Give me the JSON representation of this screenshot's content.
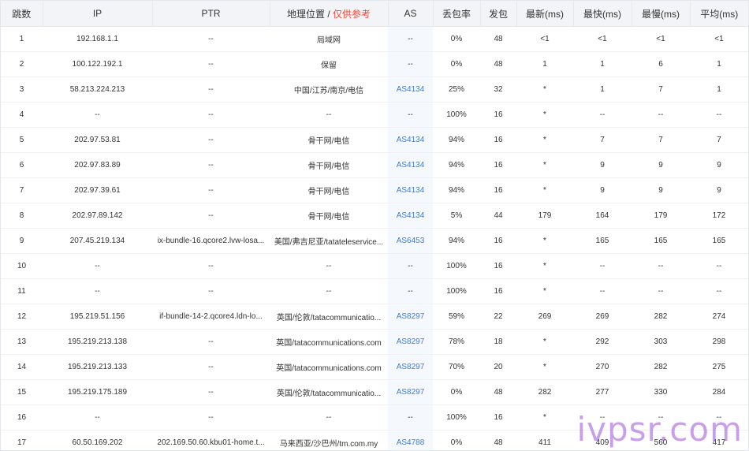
{
  "headers": {
    "hop": "跳数",
    "ip": "IP",
    "ptr": "PTR",
    "geo": "地理位置 / ",
    "geo_ref": "仅供参考",
    "as": "AS",
    "loss": "丢包率",
    "sent": "发包",
    "last": "最新(ms)",
    "best": "最快(ms)",
    "worst": "最慢(ms)",
    "avg": "平均(ms)"
  },
  "rows": [
    {
      "hop": "1",
      "ip": "192.168.1.1",
      "ptr": "--",
      "geo": "局域网",
      "as": "--",
      "loss": "0%",
      "sent": "48",
      "last": "<1",
      "best": "<1",
      "worst": "<1",
      "avg": "<1"
    },
    {
      "hop": "2",
      "ip": "100.122.192.1",
      "ptr": "--",
      "geo": "保留",
      "as": "--",
      "loss": "0%",
      "sent": "48",
      "last": "1",
      "best": "1",
      "worst": "6",
      "avg": "1"
    },
    {
      "hop": "3",
      "ip": "58.213.224.213",
      "ptr": "--",
      "geo": "中国/江苏/南京/电信",
      "as": "AS4134",
      "loss": "25%",
      "sent": "32",
      "last": "*",
      "best": "1",
      "worst": "7",
      "avg": "1"
    },
    {
      "hop": "4",
      "ip": "--",
      "ptr": "--",
      "geo": "--",
      "as": "--",
      "loss": "100%",
      "sent": "16",
      "last": "*",
      "best": "--",
      "worst": "--",
      "avg": "--"
    },
    {
      "hop": "5",
      "ip": "202.97.53.81",
      "ptr": "--",
      "geo": "骨干网/电信",
      "as": "AS4134",
      "loss": "94%",
      "sent": "16",
      "last": "*",
      "best": "7",
      "worst": "7",
      "avg": "7"
    },
    {
      "hop": "6",
      "ip": "202.97.83.89",
      "ptr": "--",
      "geo": "骨干网/电信",
      "as": "AS4134",
      "loss": "94%",
      "sent": "16",
      "last": "*",
      "best": "9",
      "worst": "9",
      "avg": "9"
    },
    {
      "hop": "7",
      "ip": "202.97.39.61",
      "ptr": "--",
      "geo": "骨干网/电信",
      "as": "AS4134",
      "loss": "94%",
      "sent": "16",
      "last": "*",
      "best": "9",
      "worst": "9",
      "avg": "9"
    },
    {
      "hop": "8",
      "ip": "202.97.89.142",
      "ptr": "--",
      "geo": "骨干网/电信",
      "as": "AS4134",
      "loss": "5%",
      "sent": "44",
      "last": "179",
      "best": "164",
      "worst": "179",
      "avg": "172"
    },
    {
      "hop": "9",
      "ip": "207.45.219.134",
      "ptr": "ix-bundle-16.qcore2.lvw-losa...",
      "geo": "美国/弗吉尼亚/tatateleservice...",
      "as": "AS6453",
      "loss": "94%",
      "sent": "16",
      "last": "*",
      "best": "165",
      "worst": "165",
      "avg": "165"
    },
    {
      "hop": "10",
      "ip": "--",
      "ptr": "--",
      "geo": "--",
      "as": "--",
      "loss": "100%",
      "sent": "16",
      "last": "*",
      "best": "--",
      "worst": "--",
      "avg": "--"
    },
    {
      "hop": "11",
      "ip": "--",
      "ptr": "--",
      "geo": "--",
      "as": "--",
      "loss": "100%",
      "sent": "16",
      "last": "*",
      "best": "--",
      "worst": "--",
      "avg": "--"
    },
    {
      "hop": "12",
      "ip": "195.219.51.156",
      "ptr": "if-bundle-14-2.qcore4.ldn-lo...",
      "geo": "英国/伦敦/tatacommunicatio...",
      "as": "AS8297",
      "loss": "59%",
      "sent": "22",
      "last": "269",
      "best": "269",
      "worst": "282",
      "avg": "274"
    },
    {
      "hop": "13",
      "ip": "195.219.213.138",
      "ptr": "--",
      "geo": "英国/tatacommunications.com",
      "as": "AS8297",
      "loss": "78%",
      "sent": "18",
      "last": "*",
      "best": "292",
      "worst": "303",
      "avg": "298"
    },
    {
      "hop": "14",
      "ip": "195.219.213.133",
      "ptr": "--",
      "geo": "英国/tatacommunications.com",
      "as": "AS8297",
      "loss": "70%",
      "sent": "20",
      "last": "*",
      "best": "270",
      "worst": "282",
      "avg": "275"
    },
    {
      "hop": "15",
      "ip": "195.219.175.189",
      "ptr": "--",
      "geo": "英国/伦敦/tatacommunicatio...",
      "as": "AS8297",
      "loss": "0%",
      "sent": "48",
      "last": "282",
      "best": "277",
      "worst": "330",
      "avg": "284"
    },
    {
      "hop": "16",
      "ip": "--",
      "ptr": "--",
      "geo": "--",
      "as": "--",
      "loss": "100%",
      "sent": "16",
      "last": "*",
      "best": "--",
      "worst": "--",
      "avg": "--"
    },
    {
      "hop": "17",
      "ip": "60.50.169.202",
      "ptr": "202.169.50.60.kbu01-home.t...",
      "geo": "马来西亚/沙巴州/tm.com.my",
      "as": "AS4788",
      "loss": "0%",
      "sent": "48",
      "last": "411",
      "best": "409",
      "worst": "560",
      "avg": "417"
    }
  ],
  "watermark": "ivpsr.com",
  "colors": {
    "header_bg": "#f3f4f7",
    "as_link": "#3b7ddd",
    "as_cell_bg": "#f5f8fd",
    "geo_ref": "#ef4a3a",
    "watermark": "#9b50d7"
  }
}
